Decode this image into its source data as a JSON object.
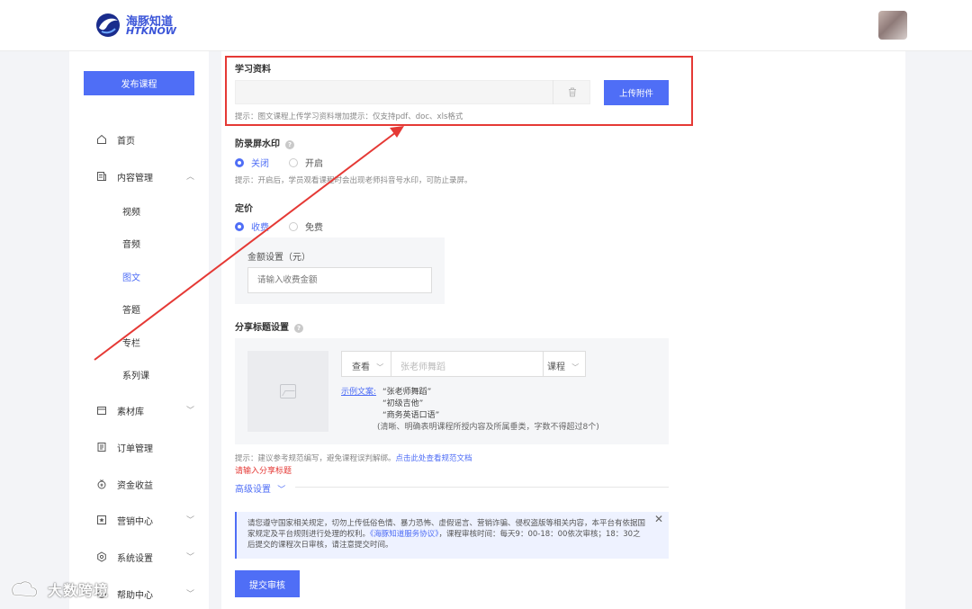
{
  "header": {
    "logo_cn": "海豚知道",
    "logo_en": "HTKNOW"
  },
  "sidebar": {
    "publish_label": "发布课程",
    "items": [
      {
        "label": "首页",
        "icon": "home-icon"
      },
      {
        "label": "内容管理",
        "icon": "content-icon",
        "expanded": true
      },
      {
        "label": "素材库",
        "icon": "folder-icon"
      },
      {
        "label": "订单管理",
        "icon": "order-icon"
      },
      {
        "label": "资金收益",
        "icon": "money-icon"
      },
      {
        "label": "营销中心",
        "icon": "marketing-icon"
      },
      {
        "label": "系统设置",
        "icon": "settings-icon"
      },
      {
        "label": "帮助中心",
        "icon": "help-icon"
      }
    ],
    "sub_items": [
      "视频",
      "音频",
      "图文",
      "答题",
      "专栏",
      "系列课"
    ],
    "active_sub": "图文"
  },
  "form": {
    "materials": {
      "title": "学习资料",
      "upload_label": "上传附件",
      "hint": "提示：图文课程上传学习资料增加提示：仅支持pdf、doc、xls格式"
    },
    "watermark": {
      "title": "防录屏水印",
      "options": [
        "关闭",
        "开启"
      ],
      "selected": "关闭",
      "hint": "提示：开启后，学员观看课程时会出现老师抖音号水印，可防止录屏。"
    },
    "pricing": {
      "title": "定价",
      "options": [
        "收费",
        "免费"
      ],
      "selected": "收费",
      "amount_label": "金额设置（元）",
      "amount_placeholder": "请输入收费金额"
    },
    "share": {
      "title": "分享标题设置",
      "prefix": "查看",
      "placeholder": "张老师舞蹈",
      "suffix": "课程",
      "example_label": "示例文案:",
      "examples": [
        "“张老师舞蹈”",
        "“初级吉他”",
        "“商务英语口语”"
      ],
      "example_note": "(清晰、明确表明课程所授内容及所属垂类，字数不得超过8个)",
      "hint_prefix": "提示：建议参考规范编写，避免课程误判解绑。",
      "hint_link": "点击此处查看规范文档",
      "error": "请输入分享标题"
    },
    "advanced_label": "高级设置",
    "notice": {
      "text_a": "请您遵守国家相关规定，切勿上传低俗色情、暴力恐怖、虚假谣言、营销诈骗、侵权盗版等相关内容，本平台有依据国家规定及平台规则进行处理的权利。",
      "link": "《海豚知道服务协议》",
      "text_b": "，课程审核时间：每天9：00-18：00依次审核；18：30之后提交的课程次日审核，请注意提交时间。"
    },
    "submit_label": "提交审核"
  },
  "watermark_overlay": {
    "text": "大数跨境"
  },
  "colors": {
    "accent": "#4f6ef6",
    "highlight": "#e53935",
    "error": "#e53935"
  }
}
